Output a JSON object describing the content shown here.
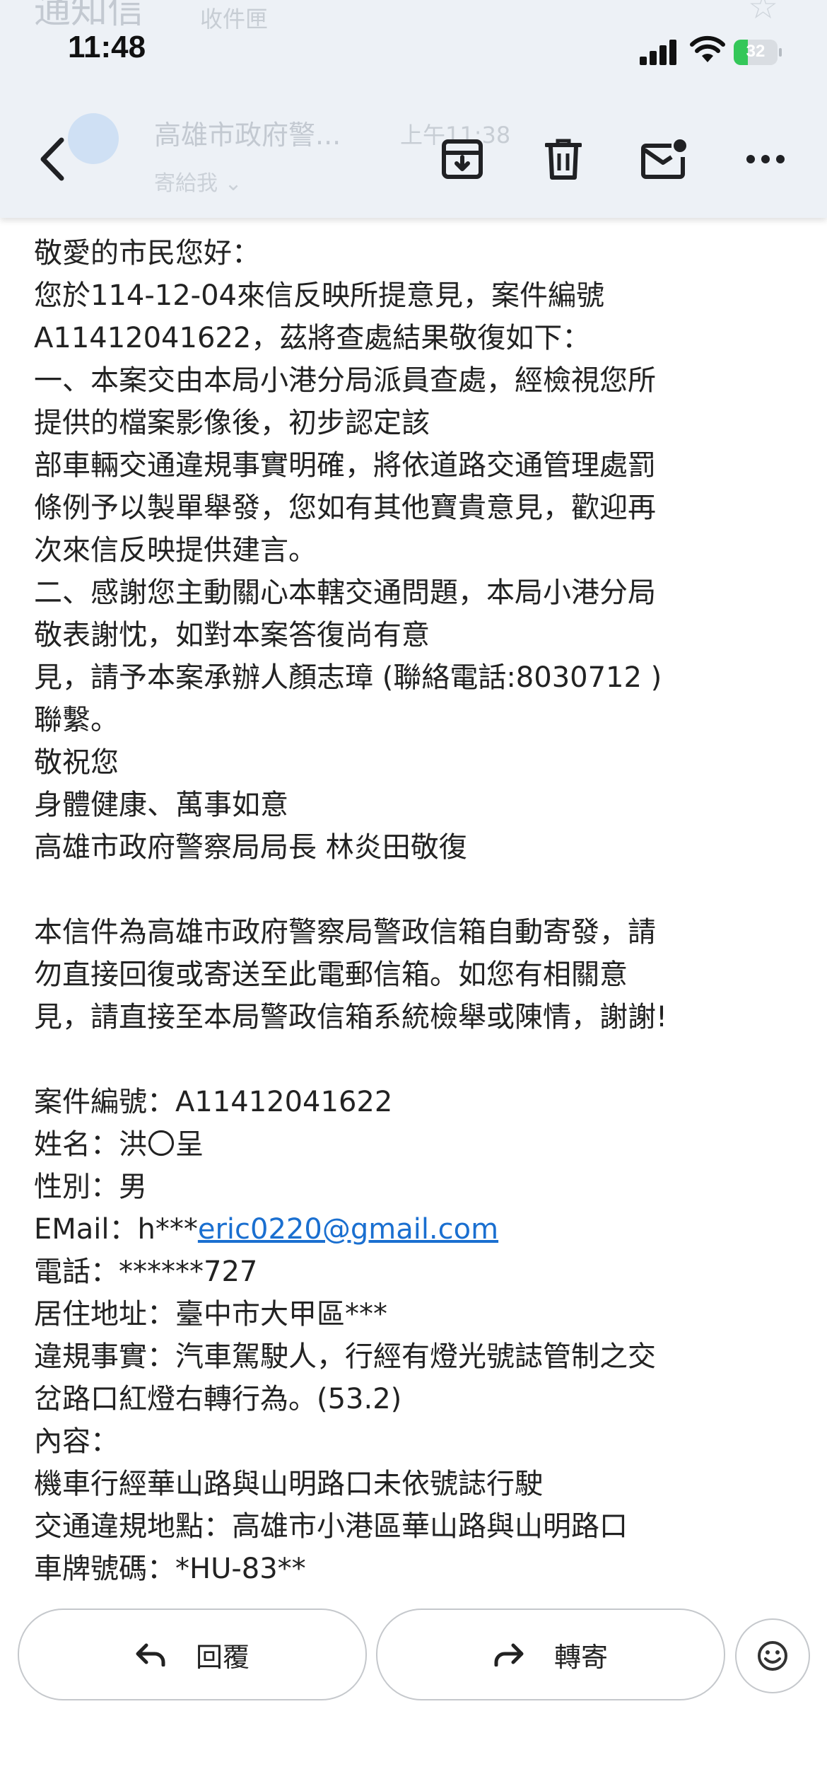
{
  "status_bar": {
    "time": "11:48",
    "battery": "32",
    "battery_level": 0.32
  },
  "background_header": {
    "subject": "通知信",
    "folder": "收件匣",
    "sender": "高雄市政府警...",
    "date": "上午11:38",
    "recipient": "寄給我"
  },
  "toolbar": {
    "back_icon": "chevron-left-icon",
    "archive_icon": "archive-icon",
    "delete_icon": "trash-icon",
    "mark_unread_icon": "mail-unread-icon",
    "more_icon": "more-horizontal-icon"
  },
  "body": {
    "greeting": "敬愛的市民您好：",
    "para1_line1": "您於114-12-04來信反映所提意見，案件編號",
    "para1_line2": "A11412041622，茲將查處結果敬復如下：",
    "para2_line1": "一、本案交由本局小港分局派員查處，經檢視您所",
    "para2_line2": "提供的檔案影像後，初步認定該",
    "para2_line3": "部車輛交通違規事實明確，將依道路交通管理處罰",
    "para2_line4": "條例予以製單舉發，您如有其他寶貴意見，歡迎再",
    "para2_line5": "次來信反映提供建言。",
    "para3_line1": "二、感謝您主動關心本轄交通問題，本局小港分局",
    "para3_line2": "敬表謝忱，如對本案答復尚有意",
    "para3_line3": "見，請予本案承辦人顏志璋 (聯絡電話:8030712 )",
    "para3_line4": "聯繫。",
    "closing1": "敬祝您",
    "closing2": "身體健康、萬事如意",
    "signature": "高雄市政府警察局局長 林炎田敬復",
    "notice_line1": "本信件為高雄市政府警察局警政信箱自動寄發，請",
    "notice_line2": "勿直接回復或寄送至此電郵信箱。如您有相關意",
    "notice_line3": "見，請直接至本局警政信箱系統檢舉或陳情，謝謝!",
    "case_no": "案件編號：A11412041622",
    "name": "姓名：洪〇呈",
    "gender": "性別：男",
    "email_prefix": "EMail：h***",
    "email_link": "eric0220@gmail.com",
    "phone": "電話：******727",
    "address": "居住地址：臺中市大甲區***",
    "violation_line1": "違規事實：汽車駕駛人，行經有燈光號誌管制之交",
    "violation_line2": "岔路口紅燈右轉行為。(53.2)",
    "content_label": "內容：",
    "content_text": "機車行經華山路與山明路口未依號誌行駛",
    "location": "交通違規地點：高雄市小港區華山路與山明路口",
    "plate": "車牌號碼：*HU-83**"
  },
  "actions": {
    "reply_label": "回覆",
    "forward_label": "轉寄",
    "emoji_icon": "smiley-icon"
  }
}
